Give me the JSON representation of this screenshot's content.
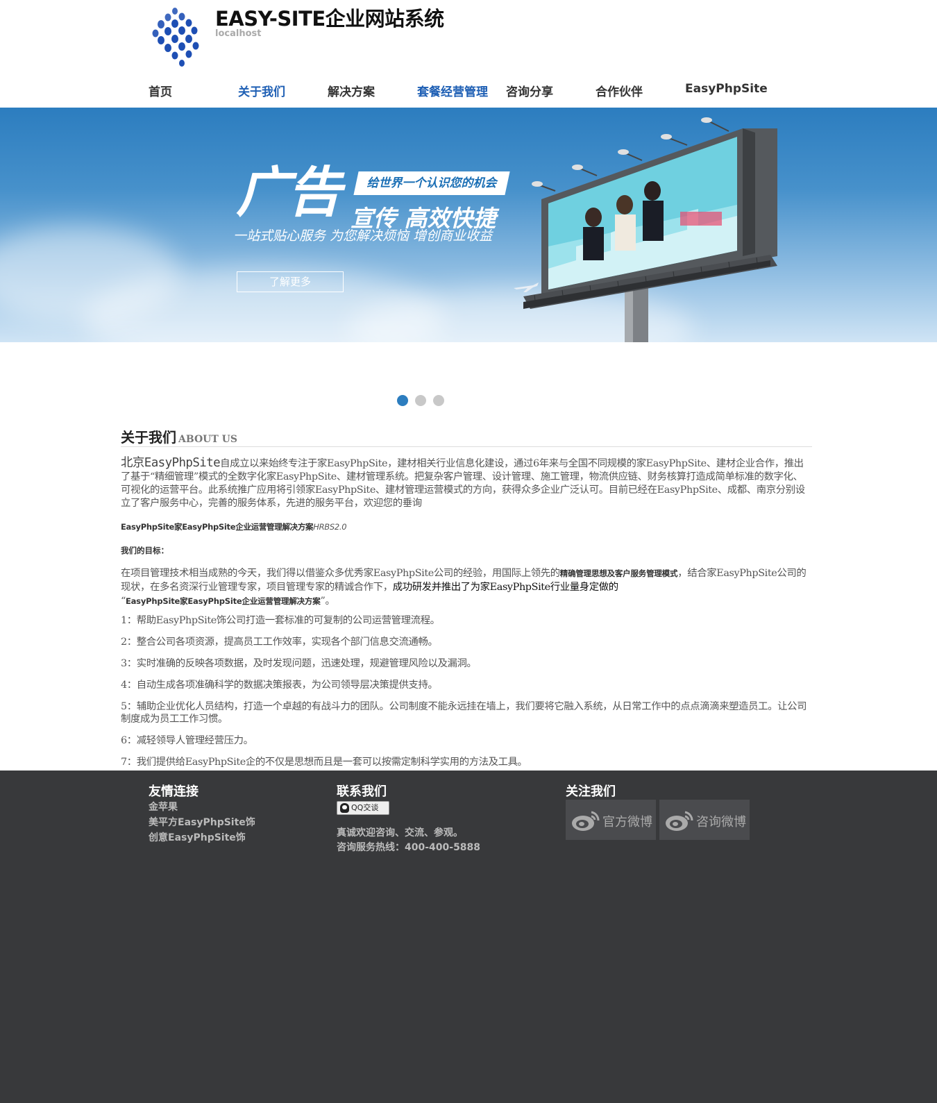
{
  "header": {
    "site_title": "EASY-SITE企业网站系统",
    "site_subtitle": "localhost"
  },
  "nav": {
    "items": [
      {
        "label": "首页",
        "active": false
      },
      {
        "label": "关于我们",
        "active": true
      },
      {
        "label": "解决方案",
        "active": false
      },
      {
        "label": "套餐经营管理",
        "active": true
      },
      {
        "label": "咨询分享",
        "active": false
      },
      {
        "label": "合作伙伴",
        "active": false
      },
      {
        "label": "EasyPhpSite",
        "active": false
      }
    ]
  },
  "banner": {
    "big_text": "广告",
    "tag_text": "给世界一个认识您的机会",
    "line2": "宣传 高效快捷",
    "line3": "一站式贴心服务  为您解决烦恼  增创商业收益",
    "button_label": "了解更多",
    "slides": 3,
    "active_slide": 0
  },
  "about": {
    "title": "关于我们",
    "title_en": "ABOUT US",
    "intro_lead": "北京EasyPhpSite",
    "intro_rest": "自成立以来始终专注于家EasyPhpSite，建材相关行业信息化建设，通过6年来与全国不同规模的家EasyPhpSite、建材企业合作，推出了基于“精细管理”模式的全数字化家EasyPhpSite、建材管理系统。把复杂客户管理、设计管理、施工管理，物流供应链、财务核算打造成简单标准的数字化、可视化的运营平台。此系统推广应用将引领家EasyPhpSite、建材管理运营模式的方向，获得众多企业广泛认可。目前已经在EasyPhpSite、成都、南京分别设立了客户服务中心，完善的服务体系，先进的服务平台，欢迎您的垂询",
    "solution_name": "EasyPhpSite家EasyPhpSite企业运营管理解决方案",
    "solution_version": "HRBS2.0",
    "goal_label": "我们的目标：",
    "goal_part1": "在项目管理技术相当成熟的今天，我们得以借鉴众多优秀家EasyPhpSite公司的经验，用国际上领先的",
    "goal_bold1": "精确管理思想及客户服务管理模式",
    "goal_part2": "，结合家EasyPhpSite公司的现状，在多名资深行业管理专家，项目管理专家的精诚合作下，",
    "goal_dark": "成功研发并推出了为家EasyPhpSite行业量身定做的",
    "goal_quote_open": "“",
    "goal_bold2": "EasyPhpSite家EasyPhpSite企业运营管理解决方案",
    "goal_quote_close": "”。",
    "points": [
      "1：帮助EasyPhpSite饰公司打造一套标准的可复制的公司运营管理流程。",
      "2：整合公司各项资源，提高员工工作效率，实现各个部门信息交流通畅。",
      "3：实时准确的反映各项数据，及时发现问题，迅速处理，规避管理风险以及漏洞。",
      "4：自动生成各项准确科学的数据决策报表，为公司领导层决策提供支持。",
      "5：辅助企业优化人员结构，打造一个卓越的有战斗力的团队。公司制度不能永远挂在墙上，我们要将它融入系统，从日常工作中的点点滴滴来塑造员工。让公司制度成为员工工作习惯。",
      "6：减轻领导人管理经营压力。",
      "7：我们提供给EasyPhpSite企的不仅是思想而且是一套可以按需定制科学实用的方法及工具。"
    ]
  },
  "footer": {
    "links_title": "友情连接",
    "links": [
      "金苹果",
      "美平方EasyPhpSite饰",
      "创意EasyPhpSite饰"
    ],
    "contact_title": "联系我们",
    "qq_label": "QQ交谈",
    "contact_line1": "真诚欢迎咨询、交流、参观。",
    "contact_line2": "咨询服务热线：400-400-5888",
    "follow_title": "关注我们",
    "weibo_official": "官方微博",
    "weibo_consult": "咨询微博"
  },
  "colors": {
    "accent": "#1e5fb4",
    "banner_blue": "#2c7dbf",
    "footer_bg": "#38393b"
  }
}
